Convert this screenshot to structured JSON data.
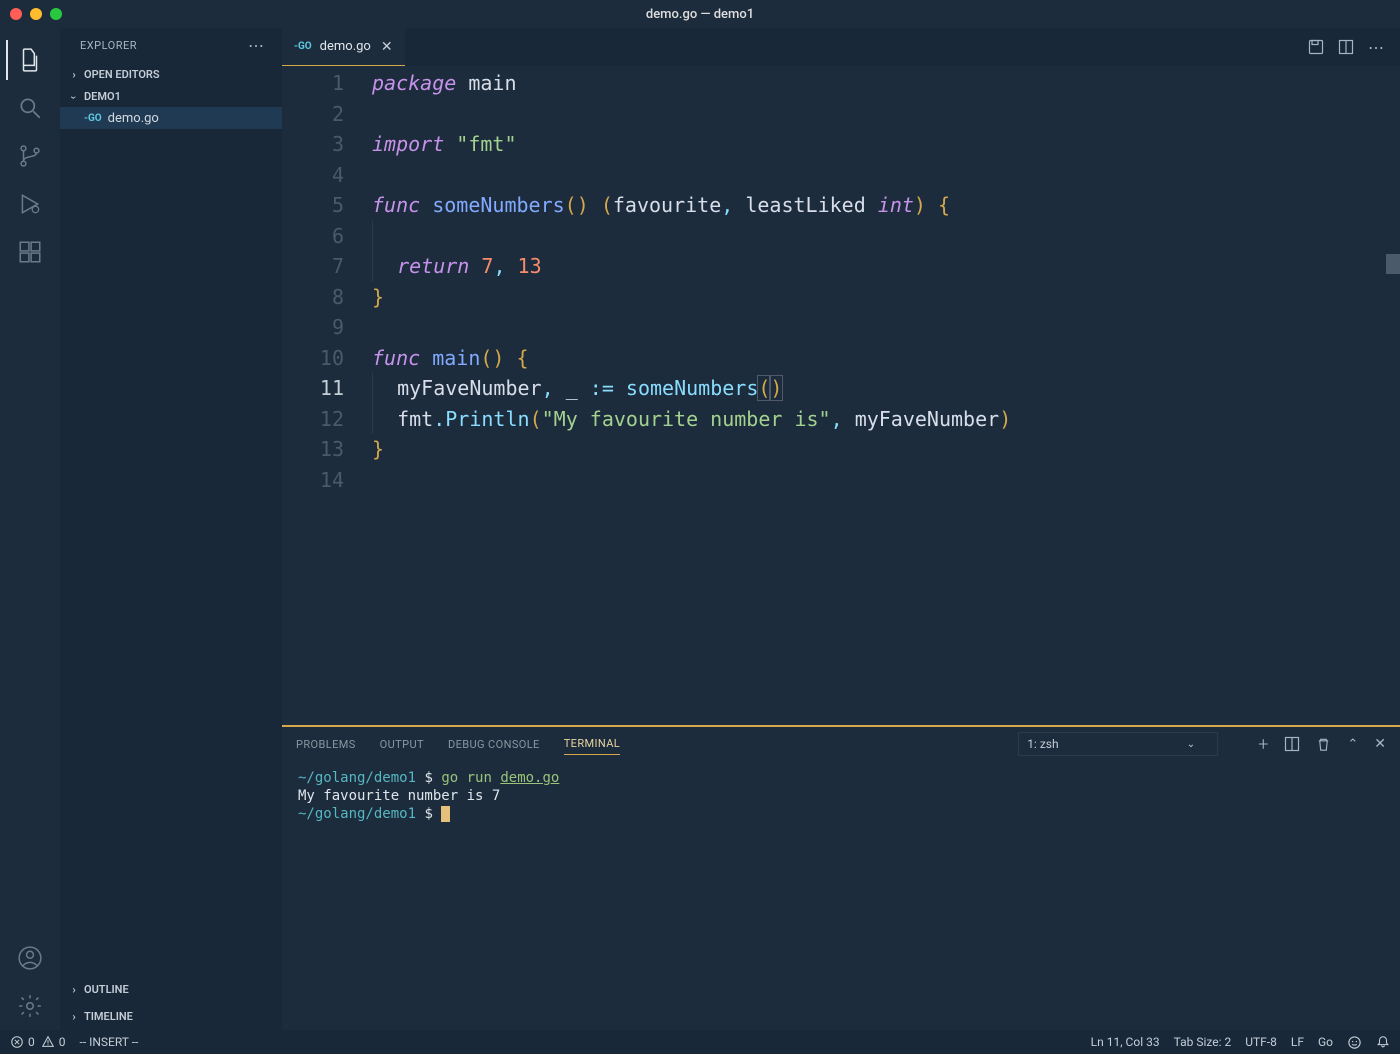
{
  "window": {
    "title": "demo.go — demo1"
  },
  "sidebar": {
    "title": "EXPLORER",
    "sections": {
      "openEditors": "OPEN EDITORS",
      "folder": "DEMO1",
      "outline": "OUTLINE",
      "timeline": "TIMELINE"
    },
    "files": [
      {
        "name": "demo.go"
      }
    ]
  },
  "tabs": [
    {
      "name": "demo.go",
      "active": true
    }
  ],
  "code": {
    "lines": [
      {
        "n": 1,
        "tokens": [
          [
            "kw",
            "package"
          ],
          [
            "",
            ""
          ],
          [
            "pkg",
            " main"
          ]
        ]
      },
      {
        "n": 2,
        "tokens": []
      },
      {
        "n": 3,
        "tokens": [
          [
            "kw",
            "import"
          ],
          [
            "",
            " "
          ],
          [
            "str",
            "\"fmt\""
          ]
        ]
      },
      {
        "n": 4,
        "tokens": []
      },
      {
        "n": 5,
        "tokens": [
          [
            "kw",
            "func"
          ],
          [
            "",
            " "
          ],
          [
            "fn",
            "someNumbers"
          ],
          [
            "paren",
            "()"
          ],
          [
            "",
            " "
          ],
          [
            "paren",
            "("
          ],
          [
            "ident",
            "favourite"
          ],
          [
            "punct",
            ","
          ],
          [
            "",
            " "
          ],
          [
            "ident",
            "leastLiked"
          ],
          [
            "",
            " "
          ],
          [
            "type",
            "int"
          ],
          [
            "paren",
            ")"
          ],
          [
            "",
            " "
          ],
          [
            "brace",
            "{"
          ]
        ]
      },
      {
        "n": 6,
        "tokens": [
          [
            "indent",
            "  "
          ]
        ]
      },
      {
        "n": 7,
        "tokens": [
          [
            "indent",
            "  "
          ],
          [
            "kw",
            "return"
          ],
          [
            "",
            " "
          ],
          [
            "num",
            "7"
          ],
          [
            "punct",
            ","
          ],
          [
            "",
            " "
          ],
          [
            "num",
            "13"
          ]
        ]
      },
      {
        "n": 8,
        "tokens": [
          [
            "brace",
            "}"
          ]
        ]
      },
      {
        "n": 9,
        "tokens": []
      },
      {
        "n": 10,
        "tokens": [
          [
            "kw",
            "func"
          ],
          [
            "",
            " "
          ],
          [
            "fn",
            "main"
          ],
          [
            "paren",
            "()"
          ],
          [
            "",
            " "
          ],
          [
            "brace",
            "{"
          ]
        ]
      },
      {
        "n": 11,
        "tokens": [
          [
            "indent",
            "  "
          ],
          [
            "ident",
            "myFaveNumber"
          ],
          [
            "punct",
            ","
          ],
          [
            "",
            " "
          ],
          [
            "ident",
            "_"
          ],
          [
            "",
            " "
          ],
          [
            "punct",
            ":="
          ],
          [
            "",
            " "
          ],
          [
            "fn2",
            "someNumbers"
          ],
          [
            "paren-box",
            "()"
          ]
        ],
        "current": true
      },
      {
        "n": 12,
        "tokens": [
          [
            "indent",
            "  "
          ],
          [
            "ident",
            "fmt"
          ],
          [
            "punct",
            "."
          ],
          [
            "fn2",
            "Println"
          ],
          [
            "paren",
            "("
          ],
          [
            "str",
            "\"My favourite number is\""
          ],
          [
            "punct",
            ","
          ],
          [
            "",
            " "
          ],
          [
            "ident",
            "myFaveNumber"
          ],
          [
            "paren",
            ")"
          ]
        ]
      },
      {
        "n": 13,
        "tokens": [
          [
            "brace",
            "}"
          ]
        ]
      },
      {
        "n": 14,
        "tokens": []
      }
    ]
  },
  "panel": {
    "tabs": [
      "PROBLEMS",
      "OUTPUT",
      "DEBUG CONSOLE",
      "TERMINAL"
    ],
    "activeTab": "TERMINAL",
    "termSelector": "1: zsh"
  },
  "terminal": {
    "line1": {
      "path": "~/golang/demo1",
      "prompt": "$",
      "cmd_pre": "go ",
      "cmd_args": "run ",
      "cmd_file": "demo.go"
    },
    "line2": "My favourite number is 7",
    "line3": {
      "path": "~/golang/demo1",
      "prompt": "$"
    }
  },
  "status": {
    "errors": "0",
    "warnings": "0",
    "mode": "-- INSERT --",
    "lncol": "Ln 11, Col 33",
    "tabSize": "Tab Size: 2",
    "encoding": "UTF-8",
    "eol": "LF",
    "lang": "Go"
  }
}
